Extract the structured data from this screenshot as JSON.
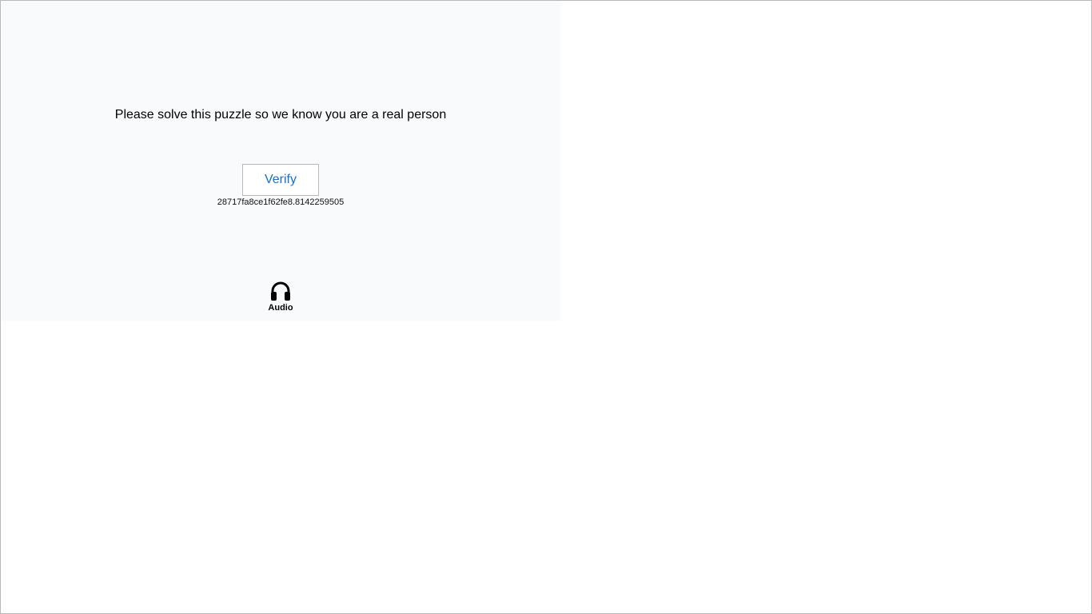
{
  "challenge": {
    "prompt": "Please solve this puzzle so we know you are a real person",
    "verify_label": "Verify",
    "session_id": "28717fa8ce1f62fe8.8142259505",
    "audio": {
      "label": "Audio",
      "icon": "headphones-icon"
    }
  },
  "colors": {
    "panel_background": "#f9fafc",
    "verify_text": "#1a6ec7",
    "border": "#b9b9b9"
  }
}
